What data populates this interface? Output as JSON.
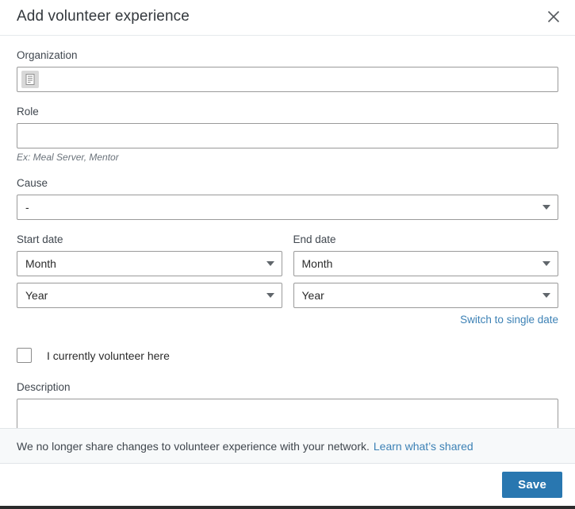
{
  "header": {
    "title": "Add volunteer experience",
    "close_icon": "close-icon"
  },
  "form": {
    "organization": {
      "label": "Organization",
      "value": "",
      "placeholder": "",
      "icon": "organization-building-icon"
    },
    "role": {
      "label": "Role",
      "value": "",
      "placeholder": "",
      "hint": "Ex: Meal Server, Mentor"
    },
    "cause": {
      "label": "Cause",
      "value": "-"
    },
    "start_date": {
      "label": "Start date",
      "month": "Month",
      "year": "Year"
    },
    "end_date": {
      "label": "End date",
      "month": "Month",
      "year": "Year"
    },
    "switch_link": "Switch to single date",
    "currently_volunteer": {
      "label": "I currently volunteer here",
      "checked": false
    },
    "description": {
      "label": "Description",
      "value": "",
      "placeholder": ""
    }
  },
  "notice": {
    "text": "We no longer share changes to volunteer experience with your network.",
    "link_text": "Learn what’s shared"
  },
  "footer": {
    "save_label": "Save"
  },
  "colors": {
    "accent": "#2977b0",
    "link": "#3c81b5",
    "notice_bg": "#f7f9fa",
    "border": "#9a9a9a"
  }
}
